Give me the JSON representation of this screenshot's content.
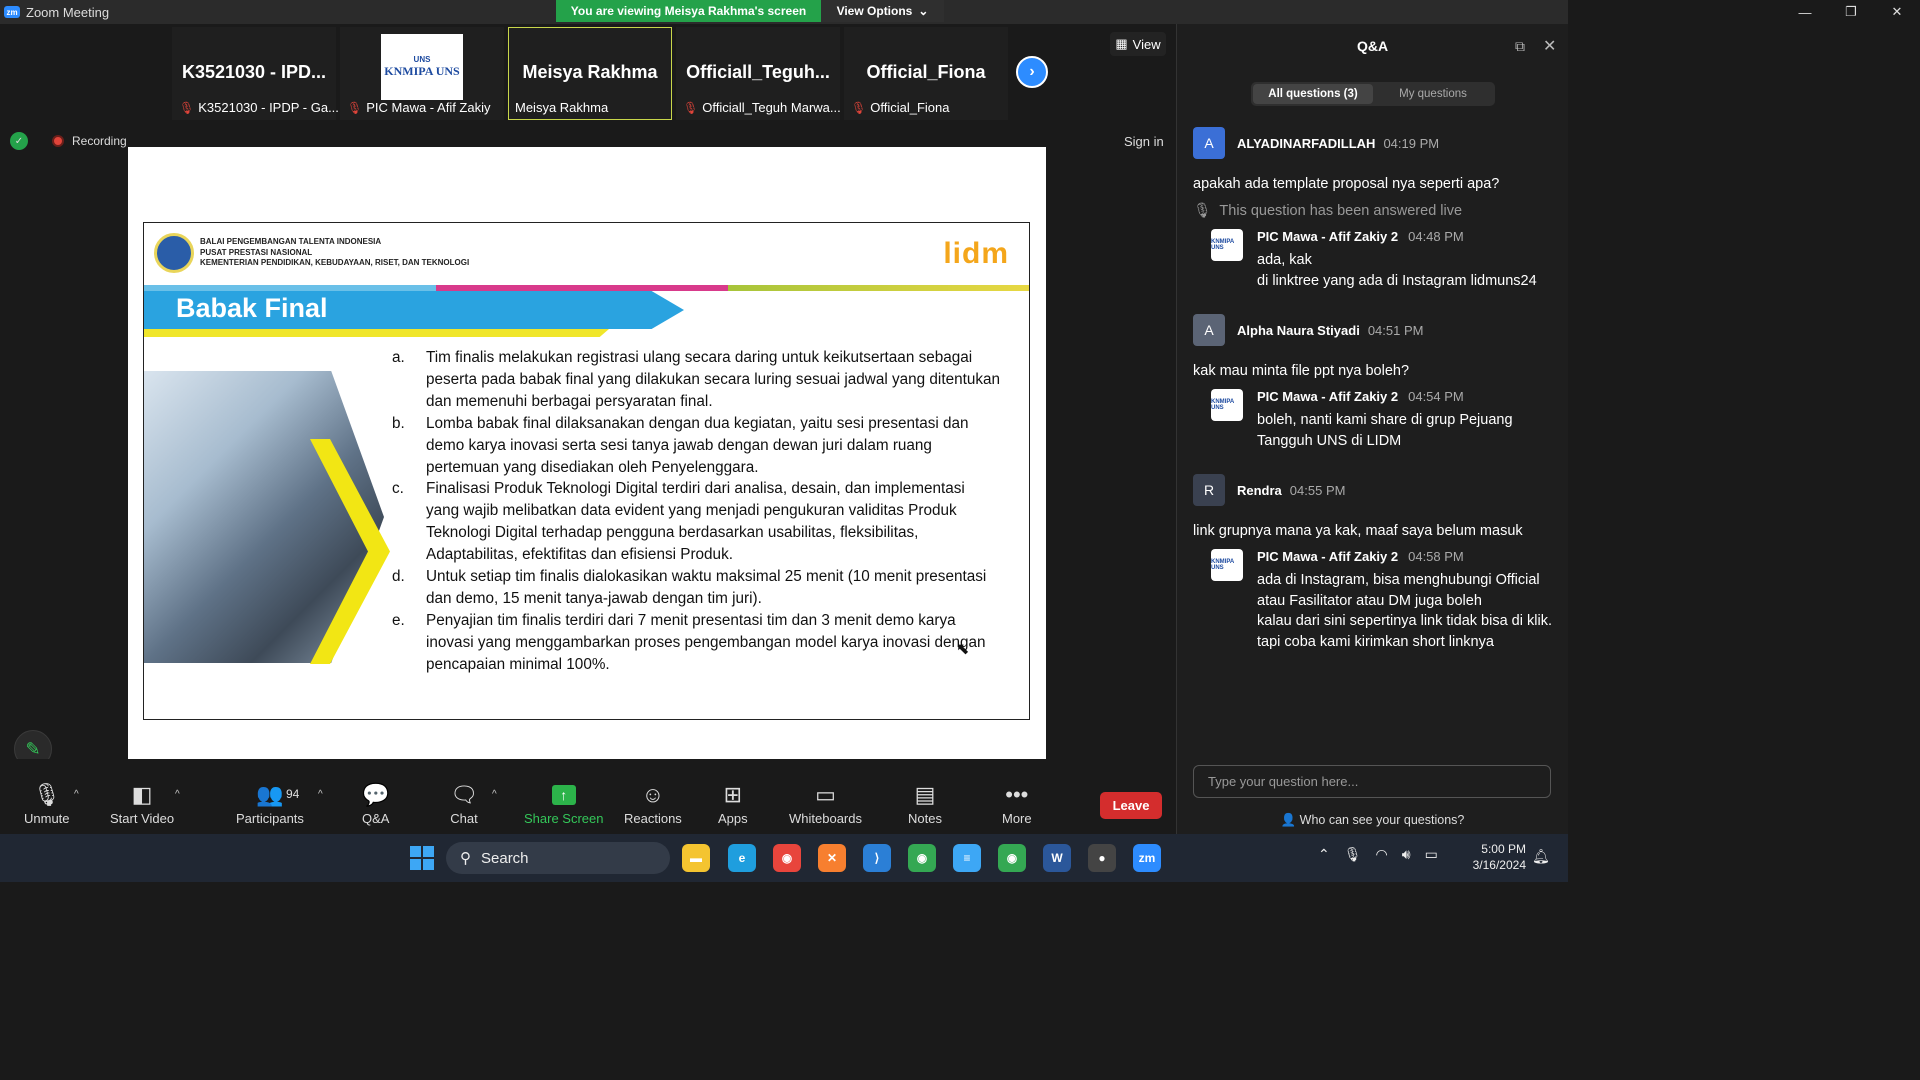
{
  "window": {
    "app_title": "Zoom Meeting",
    "logo": "zm"
  },
  "banner": {
    "viewing": "You are viewing Meisya Rakhma's screen",
    "view_options": "View Options",
    "view_options_icon": "chevron-down-icon"
  },
  "gallery": {
    "thumbs": [
      {
        "big": "K3521030 - IPD...",
        "small": "K3521030 - IPDP - Ga...",
        "muted": true,
        "active": false,
        "logo": false
      },
      {
        "big": "",
        "small": "PIC Mawa - Afif Zakiy",
        "muted": true,
        "active": false,
        "logo": true,
        "logo_top": "UNS",
        "logo_main": "KNMIPA UNS"
      },
      {
        "big": "Meisya Rakhma",
        "small": "Meisya Rakhma",
        "muted": false,
        "active": true,
        "logo": false
      },
      {
        "big": "Officiall_Teguh...",
        "small": "Officiall_Teguh Marwa...",
        "muted": true,
        "active": false,
        "logo": false
      },
      {
        "big": "Official_Fiona",
        "small": "Official_Fiona",
        "muted": true,
        "active": false,
        "logo": false
      }
    ],
    "view_label": "View",
    "recording_label": "Recording",
    "sign_in": "Sign in"
  },
  "slide": {
    "org_lines": [
      "BALAI PENGEMBANGAN TALENTA INDONESIA",
      "PUSAT PRESTASI NASIONAL",
      "KEMENTERIAN PENDIDIKAN, KEBUDAYAAN, RISET, DAN TEKNOLOGI"
    ],
    "brand": "lidm",
    "title": "Babak Final",
    "items": [
      {
        "key": "a.",
        "text": "Tim finalis melakukan registrasi ulang secara daring untuk keikutsertaan sebagai peserta pada babak final yang dilakukan secara luring sesuai jadwal yang ditentukan dan memenuhi berbagai persyaratan final."
      },
      {
        "key": "b.",
        "text": "Lomba babak final dilaksanakan dengan dua kegiatan, yaitu sesi presentasi dan demo karya inovasi serta sesi tanya jawab dengan dewan juri dalam ruang pertemuan yang disediakan oleh Penyelenggara."
      },
      {
        "key": "c.",
        "text": "Finalisasi Produk Teknologi Digital terdiri dari analisa, desain, dan implementasi yang wajib melibatkan data evident yang menjadi pengukuran validitas Produk Teknologi Digital terhadap pengguna berdasarkan usabilitas, fleksibilitas, Adaptabilitas, efektifitas dan efisiensi Produk."
      },
      {
        "key": "d.",
        "text": "Untuk setiap tim finalis dialokasikan waktu maksimal 25 menit (10 menit presentasi dan demo, 15 menit tanya-jawab dengan tim juri)."
      },
      {
        "key": "e.",
        "text": "Penyajian tim finalis terdiri dari 7 menit presentasi tim dan 3 menit demo karya inovasi yang menggambarkan proses pengembangan model karya inovasi dengan pencapaian minimal 100%."
      }
    ]
  },
  "qa": {
    "title": "Q&A",
    "tab_all": "All questions (3)",
    "tab_mine": "My questions",
    "questions": [
      {
        "initial": "A",
        "avatar_color": "#3b6fd6",
        "name": "ALYADINARFADILLAH",
        "time": "04:19 PM",
        "text": "apakah ada template proposal nya seperti apa?",
        "answered_live": "This question has been answered live",
        "reply": {
          "name": "PIC Mawa - Afif Zakiy 2",
          "time": "04:48 PM",
          "lines": [
            "ada, kak",
            "di linktree yang ada di Instagram lidmuns24"
          ]
        }
      },
      {
        "initial": "A",
        "avatar_color": "#5b6475",
        "name": "Alpha Naura Stiyadi",
        "time": "04:51 PM",
        "text": "kak mau minta file ppt nya boleh?",
        "answered_live": "",
        "reply": {
          "name": "PIC Mawa - Afif Zakiy 2",
          "time": "04:54 PM",
          "lines": [
            "boleh, nanti kami share di grup Pejuang Tangguh UNS di LIDM"
          ]
        }
      },
      {
        "initial": "R",
        "avatar_color": "#3a4150",
        "name": "Rendra",
        "time": "04:55 PM",
        "text": "link grupnya mana ya kak, maaf saya belum masuk",
        "answered_live": "",
        "reply": {
          "name": "PIC Mawa - Afif Zakiy 2",
          "time": "04:58 PM",
          "lines": [
            "ada di Instagram, bisa menghubungi Official atau Fasilitator atau DM juga boleh",
            "kalau dari sini sepertinya link tidak bisa di klik.",
            "tapi coba kami kirimkan short linknya"
          ]
        }
      }
    ],
    "input_placeholder": "Type your question here...",
    "who_can_see": "Who can see your questions?"
  },
  "toolbar": {
    "unmute": "Unmute",
    "start_video": "Start Video",
    "participants": "Participants",
    "participant_count": "94",
    "qa": "Q&A",
    "chat": "Chat",
    "share_screen": "Share Screen",
    "reactions": "Reactions",
    "apps": "Apps",
    "whiteboards": "Whiteboards",
    "notes": "Notes",
    "more": "More",
    "leave": "Leave"
  },
  "taskbar": {
    "search": "Search",
    "time": "5:00 PM",
    "date": "3/16/2024",
    "apps": [
      {
        "name": "file-explorer-icon",
        "color": "#f4c430",
        "glyph": "▬"
      },
      {
        "name": "edge-icon",
        "color": "#1f9ede",
        "glyph": "e"
      },
      {
        "name": "chrome-icon",
        "color": "#e8453c",
        "glyph": "◉"
      },
      {
        "name": "xampp-icon",
        "color": "#f77f2f",
        "glyph": "✕"
      },
      {
        "name": "vscode-icon",
        "color": "#2b7fd6",
        "glyph": "⟩"
      },
      {
        "name": "chrome-profile-icon",
        "color": "#34a853",
        "glyph": "◉"
      },
      {
        "name": "notepad-icon",
        "color": "#3da7f5",
        "glyph": "≡"
      },
      {
        "name": "chrome-profile2-icon",
        "color": "#34a853",
        "glyph": "◉"
      },
      {
        "name": "word-icon",
        "color": "#2b579a",
        "glyph": "W"
      },
      {
        "name": "obs-icon",
        "color": "#444",
        "glyph": "●"
      },
      {
        "name": "zoom-icon",
        "color": "#2d8cff",
        "glyph": "zm"
      }
    ]
  },
  "colors": {
    "accent": "#2d8cff",
    "leave": "#d42d2d",
    "share": "#2cb34a",
    "banner": "#24a24a"
  }
}
